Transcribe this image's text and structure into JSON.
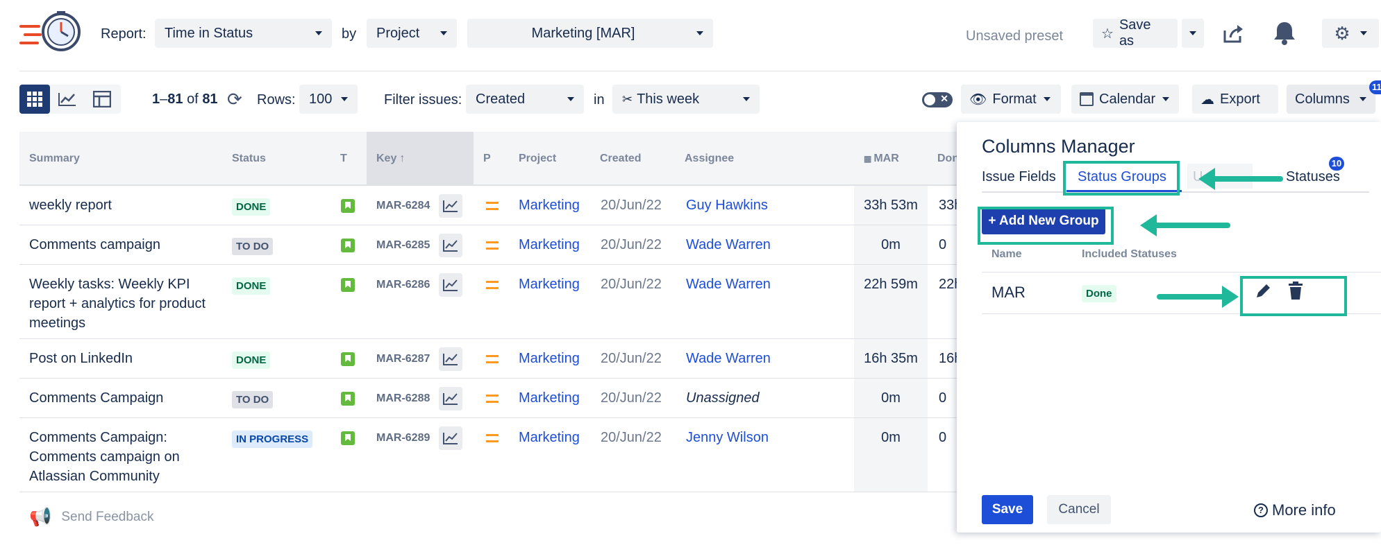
{
  "topbar": {
    "report_label": "Report:",
    "report_value": "Time in Status",
    "by_label": "by",
    "by_value": "Project",
    "project_value": "Marketing [MAR]",
    "preset_status": "Unsaved preset",
    "save_as_label": "Save as"
  },
  "toolbar": {
    "range_start": "1",
    "range_sep": "–",
    "range_end": "81",
    "range_of": "of",
    "range_total": "81",
    "rows_label": "Rows:",
    "rows_value": "100",
    "filter_label": "Filter issues:",
    "filter_value": "Created",
    "in_label": "in",
    "period_value": "This week",
    "format_label": "Format",
    "calendar_label": "Calendar",
    "export_label": "Export",
    "columns_label": "Columns",
    "columns_badge": "11"
  },
  "table": {
    "headers": {
      "summary": "Summary",
      "status": "Status",
      "type": "T",
      "key": "Key",
      "priority": "P",
      "project": "Project",
      "created": "Created",
      "assignee": "Assignee",
      "mar": "MAR",
      "done": "Don"
    },
    "rows": [
      {
        "summary": [
          "weekly report"
        ],
        "status": "DONE",
        "status_kind": "done",
        "key": "MAR-6284",
        "project": "Marketing",
        "created": "20/Jun/22",
        "assignee": "Guy Hawkins",
        "mar": "33h 53m",
        "done": "33h"
      },
      {
        "summary": [
          "Comments campaign"
        ],
        "status": "TO DO",
        "status_kind": "todo",
        "key": "MAR-6285",
        "project": "Marketing",
        "created": "20/Jun/22",
        "assignee": "Wade Warren",
        "mar": "0m",
        "done": "0"
      },
      {
        "summary": [
          "Weekly tasks: Weekly KPI",
          "report + analytics for product",
          "meetings"
        ],
        "status": "DONE",
        "status_kind": "done",
        "key": "MAR-6286",
        "project": "Marketing",
        "created": "20/Jun/22",
        "assignee": "Wade Warren",
        "mar": "22h 59m",
        "done": "22h"
      },
      {
        "summary": [
          "Post on LinkedIn"
        ],
        "status": "DONE",
        "status_kind": "done",
        "key": "MAR-6287",
        "project": "Marketing",
        "created": "20/Jun/22",
        "assignee": "Wade Warren",
        "mar": "16h 35m",
        "done": "16h"
      },
      {
        "summary": [
          "Comments Campaign"
        ],
        "status": "TO DO",
        "status_kind": "todo",
        "key": "MAR-6288",
        "project": "Marketing",
        "created": "20/Jun/22",
        "assignee": "Unassigned",
        "mar": "0m",
        "done": "0"
      },
      {
        "summary": [
          "Comments Campaign:",
          "Comments campaign on",
          "Atlassian Community"
        ],
        "status": "IN PROGRESS",
        "status_kind": "prog",
        "key": "MAR-6289",
        "project": "Marketing",
        "created": "20/Jun/22",
        "assignee": "Jenny Wilson",
        "mar": "0m",
        "done": "0"
      }
    ]
  },
  "feedback_label": "Send Feedback",
  "columns_manager": {
    "title": "Columns Manager",
    "tabs": {
      "issue_fields": "Issue Fields",
      "status_groups": "Status Groups",
      "hidden_tab": "U",
      "statuses": "Statuses",
      "statuses_badge": "10"
    },
    "add_group_label": "+ Add New Group",
    "col_name": "Name",
    "col_included": "Included Statuses",
    "group": {
      "name": "MAR",
      "status": "Done"
    },
    "save_label": "Save",
    "cancel_label": "Cancel",
    "more_info_label": "More info"
  },
  "colors": {
    "accent": "#1d4ed8",
    "highlight": "#1fb89a",
    "done_bg": "#e3fcef",
    "progress_bg": "#deebff"
  }
}
